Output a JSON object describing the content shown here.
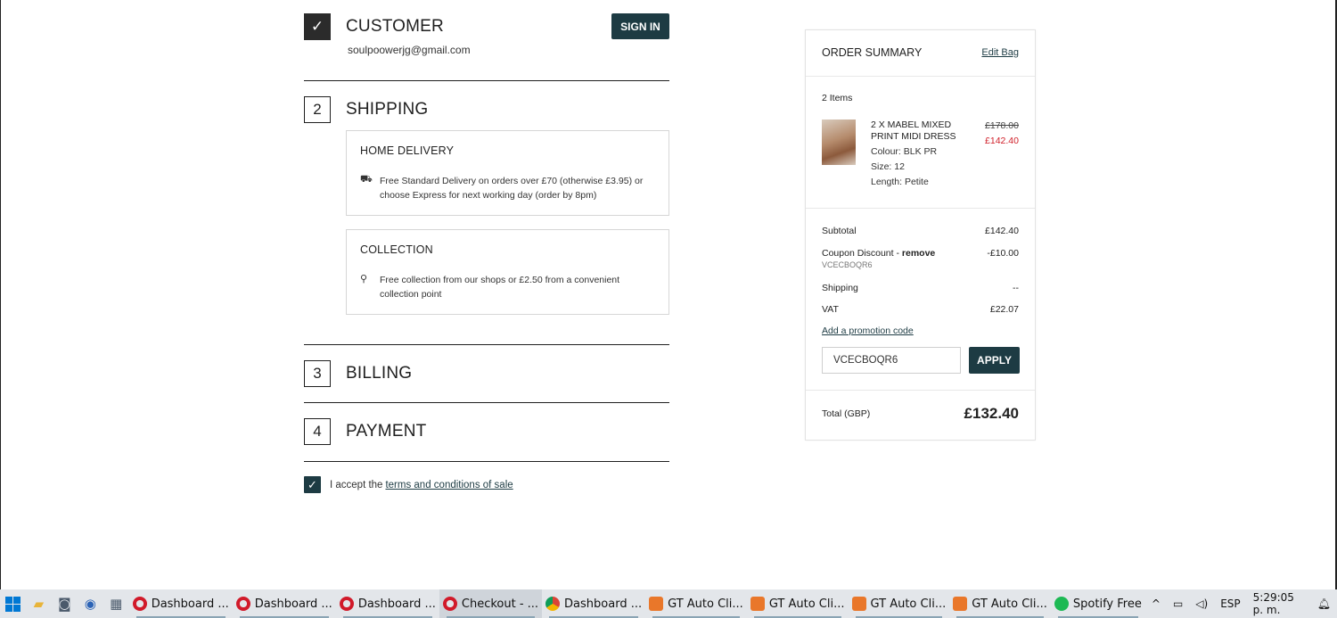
{
  "checkout": {
    "customer": {
      "title": "CUSTOMER",
      "email": "soulpoowerjg@gmail.com",
      "signin_label": "SIGN IN"
    },
    "shipping": {
      "number": "2",
      "title": "SHIPPING",
      "options": [
        {
          "title": "HOME DELIVERY",
          "icon": "truck-icon",
          "text": "Free Standard Delivery on orders over £70 (otherwise £3.95) or choose Express for next working day (order by 8pm)"
        },
        {
          "title": "COLLECTION",
          "icon": "location-pin-icon",
          "text": "Free collection from our shops or £2.50 from a convenient collection point"
        }
      ]
    },
    "billing": {
      "number": "3",
      "title": "BILLING"
    },
    "payment": {
      "number": "4",
      "title": "PAYMENT"
    },
    "terms": {
      "prefix": "I accept the",
      "link": "terms and conditions of sale"
    }
  },
  "summary": {
    "title": "ORDER SUMMARY",
    "edit_bag": "Edit Bag",
    "items_count": "2 Items",
    "item": {
      "name": "2 X MABEL MIXED PRINT MIDI DRESS",
      "colour": "Colour: BLK PR",
      "size": "Size: 12",
      "length": "Length: Petite",
      "price_old": "£178.00",
      "price_new": "£142.40"
    },
    "subtotal_label": "Subtotal",
    "subtotal": "£142.40",
    "coupon_label": "Coupon Discount - ",
    "coupon_remove": "remove",
    "coupon_code": "VCECBOQR6",
    "coupon_value": "-£10.00",
    "shipping_label": "Shipping",
    "shipping": "--",
    "vat_label": "VAT",
    "vat": "£22.07",
    "promo_link": "Add a promotion code",
    "promo_value": "VCECBOQR6",
    "apply_label": "APPLY",
    "total_label": "Total (GBP)",
    "total": "£132.40"
  },
  "taskbar": {
    "apps": [
      {
        "label": "Dashboard ...",
        "icon": "opera"
      },
      {
        "label": "Dashboard ...",
        "icon": "opera"
      },
      {
        "label": "Dashboard ...",
        "icon": "opera"
      },
      {
        "label": "Checkout - ...",
        "icon": "opera"
      },
      {
        "label": "Dashboard ...",
        "icon": "chrome"
      },
      {
        "label": "GT Auto Cli...",
        "icon": "gt"
      },
      {
        "label": "GT Auto Cli...",
        "icon": "gt"
      },
      {
        "label": "GT Auto Cli...",
        "icon": "gt"
      },
      {
        "label": "GT Auto Cli...",
        "icon": "gt"
      },
      {
        "label": "Spotify Free",
        "icon": "spotify"
      }
    ],
    "language": "ESP",
    "clock": "5:29:05 p. m."
  }
}
